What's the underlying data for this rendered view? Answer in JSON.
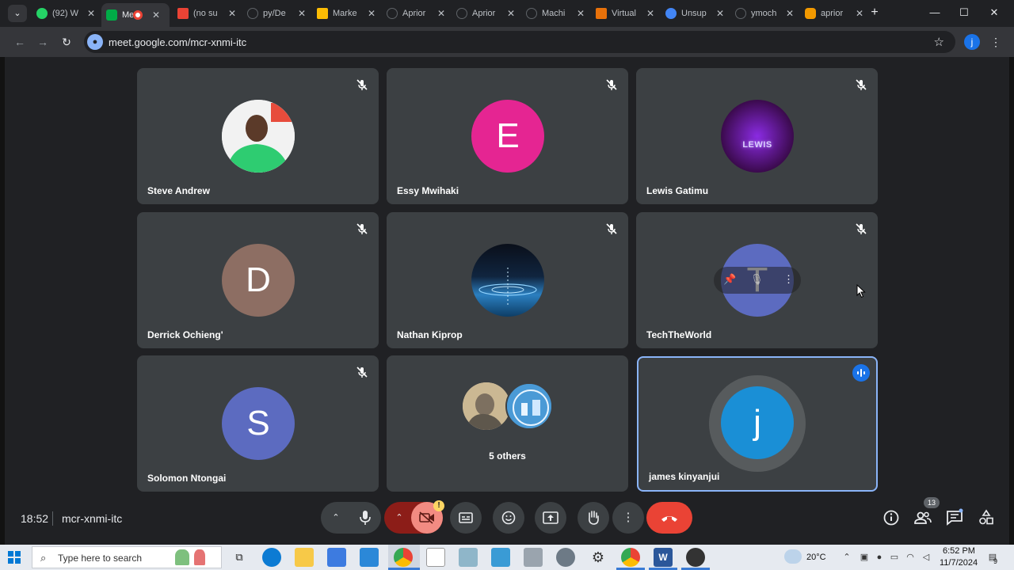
{
  "browser": {
    "tabs": [
      {
        "title": "(92) W",
        "active": false,
        "favicon_color": "#25d366"
      },
      {
        "title": "Me",
        "active": true,
        "favicon_color": "#00ac47"
      },
      {
        "title": "(no su",
        "active": false,
        "favicon_color": "#ea4335"
      },
      {
        "title": "py/De",
        "active": false,
        "favicon_color": "#5f6368"
      },
      {
        "title": "Marke",
        "active": false,
        "favicon_color": "#fbbc04"
      },
      {
        "title": "Aprior",
        "active": false,
        "favicon_color": "#5f6368"
      },
      {
        "title": "Aprior",
        "active": false,
        "favicon_color": "#5f6368"
      },
      {
        "title": "Machi",
        "active": false,
        "favicon_color": "#5f6368"
      },
      {
        "title": "Virtual",
        "active": false,
        "favicon_color": "#e8710a"
      },
      {
        "title": "Unsup",
        "active": false,
        "favicon_color": "#4285f4"
      },
      {
        "title": "ymoch",
        "active": false,
        "favicon_color": "#5f6368"
      },
      {
        "title": "aprior",
        "active": false,
        "favicon_color": "#f29900"
      }
    ],
    "url": "meet.google.com/mcr-xnmi-itc",
    "profile_initial": "j"
  },
  "participants": [
    {
      "name": "Steve Andrew",
      "avatar_type": "photo",
      "avatar_color": "#2ecc71",
      "muted": true
    },
    {
      "name": "Essy Mwihaki",
      "avatar_type": "letter",
      "initial": "E",
      "avatar_color": "#e52592",
      "muted": true
    },
    {
      "name": "Lewis Gatimu",
      "avatar_type": "logo",
      "logo_text": "LEWIS",
      "avatar_color": "#4a0a5e",
      "muted": true
    },
    {
      "name": "Derrick Ochieng'",
      "avatar_type": "letter",
      "initial": "D",
      "avatar_color": "#8d6e63",
      "muted": true
    },
    {
      "name": "Nathan Kiprop",
      "avatar_type": "photo",
      "avatar_color": "#1e5c8a",
      "muted": true
    },
    {
      "name": "TechTheWorld",
      "avatar_type": "letter",
      "initial": "T",
      "avatar_color": "#5c6bc0",
      "muted": true
    },
    {
      "name": "Solomon Ntongai",
      "avatar_type": "letter",
      "initial": "S",
      "avatar_color": "#5c6bc0",
      "muted": true
    },
    {
      "name": "5 others",
      "avatar_type": "group",
      "muted": false
    },
    {
      "name": "james kinyanjui",
      "avatar_type": "letter",
      "initial": "j",
      "avatar_color": "#1a8fd6",
      "muted": false,
      "speaking": true
    }
  ],
  "meeting": {
    "time": "18:52",
    "code": "mcr-xnmi-itc",
    "participant_count": "13",
    "camera_warning": "!"
  },
  "taskbar": {
    "search_placeholder": "Type here to search",
    "temperature": "20°C",
    "time": "6:52 PM",
    "date": "11/7/2024",
    "notification_count": "9"
  }
}
